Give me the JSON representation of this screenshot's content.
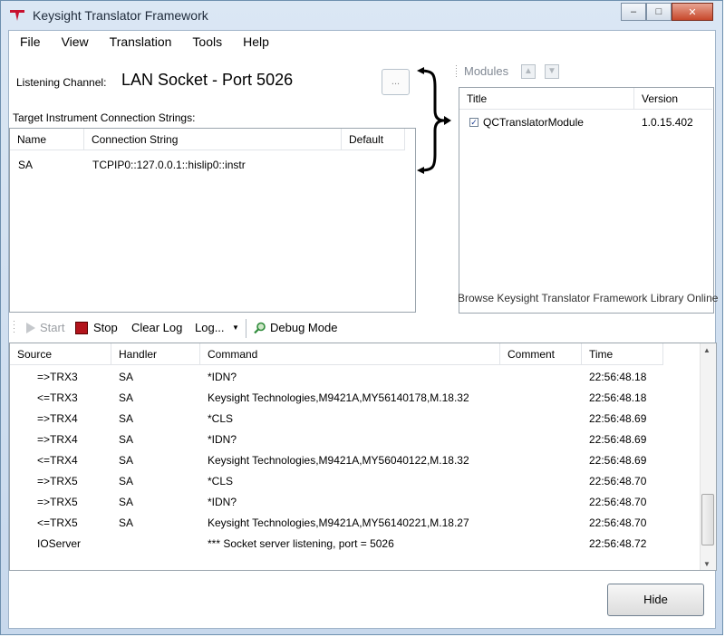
{
  "window": {
    "title": "Keysight Translator Framework",
    "accent": "#c8102e",
    "caption_buttons": {
      "minimize": "‒",
      "maximize": "□",
      "close": "✕"
    }
  },
  "menu": [
    "File",
    "View",
    "Translation",
    "Tools",
    "Help"
  ],
  "listening": {
    "label": "Listening Channel:",
    "value": "LAN Socket - Port 5026",
    "browse_label": "..."
  },
  "targets": {
    "label": "Target Instrument Connection Strings:",
    "columns": [
      "Name",
      "Connection String",
      "Default"
    ],
    "rows": [
      {
        "name": "SA",
        "connection": "TCPIP0::127.0.0.1::hislip0::instr",
        "default": ""
      }
    ]
  },
  "modules": {
    "label": "Modules",
    "up_icon": "arrow-up-icon",
    "down_icon": "arrow-down-icon",
    "columns": [
      "Title",
      "Version"
    ],
    "rows": [
      {
        "checked": true,
        "title": "QCTranslatorModule",
        "version": "1.0.15.402"
      }
    ],
    "library_link": "Browse Keysight Translator Framework Library Online"
  },
  "toolbar": {
    "start": "Start",
    "stop": "Stop",
    "clear_log": "Clear Log",
    "log": "Log...",
    "debug_mode": "Debug Mode"
  },
  "log": {
    "columns": [
      "Source",
      "Handler",
      "Command",
      "Comment",
      "Time"
    ],
    "rows": [
      {
        "source": "=>TRX3",
        "handler": "SA",
        "command": "*IDN?",
        "comment": "",
        "time": "22:56:48.18"
      },
      {
        "source": "<=TRX3",
        "handler": "SA",
        "command": "Keysight Technologies,M9421A,MY56140178,M.18.32",
        "comment": "",
        "time": "22:56:48.18"
      },
      {
        "source": "=>TRX4",
        "handler": "SA",
        "command": "*CLS",
        "comment": "",
        "time": "22:56:48.69"
      },
      {
        "source": "=>TRX4",
        "handler": "SA",
        "command": "*IDN?",
        "comment": "",
        "time": "22:56:48.69"
      },
      {
        "source": "<=TRX4",
        "handler": "SA",
        "command": "Keysight Technologies,M9421A,MY56040122,M.18.32",
        "comment": "",
        "time": "22:56:48.69"
      },
      {
        "source": "=>TRX5",
        "handler": "SA",
        "command": "*CLS",
        "comment": "",
        "time": "22:56:48.70"
      },
      {
        "source": "=>TRX5",
        "handler": "SA",
        "command": "*IDN?",
        "comment": "",
        "time": "22:56:48.70"
      },
      {
        "source": "<=TRX5",
        "handler": "SA",
        "command": "Keysight Technologies,M9421A,MY56140221,M.18.27",
        "comment": "",
        "time": "22:56:48.70"
      },
      {
        "source": "IOServer",
        "handler": "",
        "command": "***  Socket server listening, port = 5026",
        "comment": "",
        "time": "22:56:48.72"
      }
    ]
  },
  "hide_label": "Hide"
}
